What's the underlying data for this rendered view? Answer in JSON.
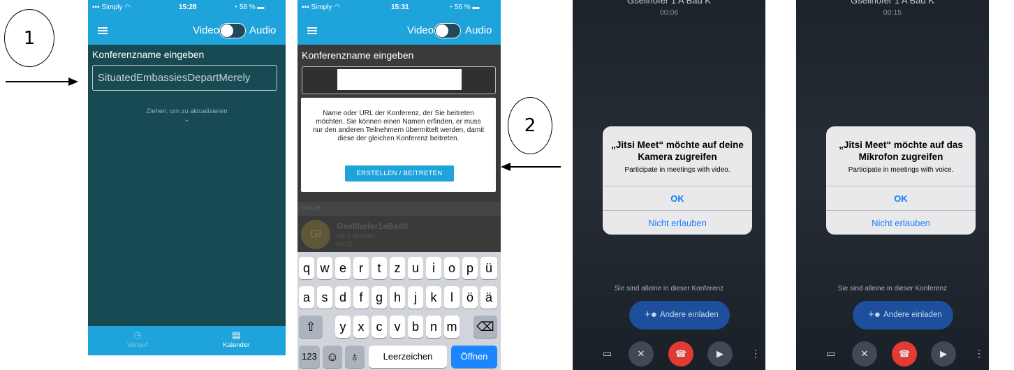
{
  "annotations": {
    "step1": "1",
    "step2": "2"
  },
  "phone1": {
    "status": {
      "carrier": "Simply",
      "time": "15:28",
      "battery": "58 %"
    },
    "toggle": {
      "video": "Video",
      "audio": "Audio"
    },
    "label": "Konferenzname eingeben",
    "input_value": "SituatedEmbassiesDepartMerely",
    "pull_hint": "Ziehen, um zu aktualisieren",
    "tabs": {
      "history": "Verlauf",
      "calendar": "Kalender"
    }
  },
  "phone2": {
    "status": {
      "carrier": "Simply",
      "time": "15:31",
      "battery": "56 %"
    },
    "toggle": {
      "video": "Video",
      "audio": "Audio"
    },
    "label": "Konferenzname eingeben",
    "dialog_text": "Name oder URL der Konferenz, der Sie beitreten möchten. Sie können einen Namen erfinden, er muss nur den anderen Teilnehmern übermittelt werden, damit diese der gleichen Konferenz beitreten.",
    "dialog_button": "ERSTELLEN / BEITRETEN",
    "section": "Heute",
    "recent": {
      "initials": "GI",
      "name": "Gsellhofer1aBadK",
      "ago": "vor 2 Minuten",
      "duration": "00:32"
    },
    "keyboard": {
      "row1": [
        "q",
        "w",
        "e",
        "r",
        "t",
        "z",
        "u",
        "i",
        "o",
        "p",
        "ü"
      ],
      "row2": [
        "a",
        "s",
        "d",
        "f",
        "g",
        "h",
        "j",
        "k",
        "l",
        "ö",
        "ä"
      ],
      "row3": [
        "y",
        "x",
        "c",
        "v",
        "b",
        "n",
        "m"
      ],
      "numbers": "123",
      "space": "Leerzeichen",
      "go": "Öffnen"
    }
  },
  "phone3": {
    "title": "Gsellhofer 1 A Bad K",
    "timer": "00:06",
    "alert": {
      "title": "„Jitsi Meet“ möchte auf deine Kamera zugreifen",
      "message": "Participate in meetings with video.",
      "ok": "OK",
      "deny": "Nicht erlauben"
    },
    "alone": "Sie sind alleine in dieser Konferenz",
    "invite": "Andere einladen"
  },
  "phone4": {
    "title": "Gsellhofer 1 A Bad K",
    "timer": "00:15",
    "alert": {
      "title": "„Jitsi Meet“ möchte auf das Mikrofon zugreifen",
      "message": "Participate in meetings with voice.",
      "ok": "OK",
      "deny": "Nicht erlauben"
    },
    "alone": "Sie sind alleine in dieser Konferenz",
    "invite": "Andere einladen"
  }
}
